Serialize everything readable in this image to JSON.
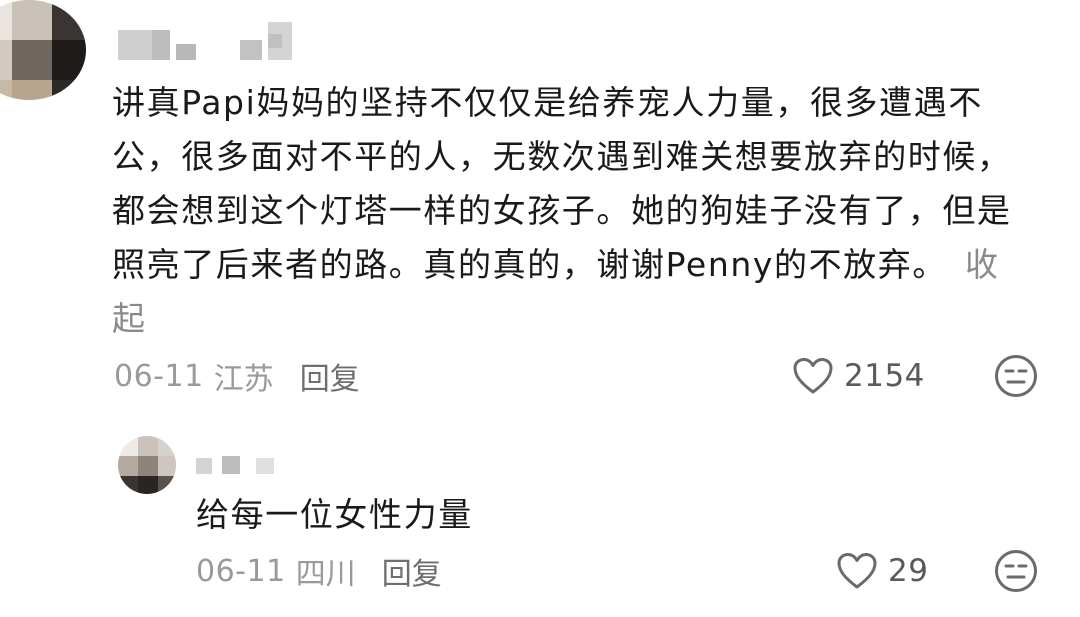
{
  "comment": {
    "text": "讲真Papi妈妈的坚持不仅仅是给养宠人力量，很多遭遇不公，很多面对不平的人，无数次遇到难关想要放弃的时候，都会想到这个灯塔一样的女孩子。她的狗娃子没有了，但是照亮了后来者的路。真的真的，谢谢Penny的不放弃。",
    "collapse_label": "收起",
    "date": "06-11",
    "location": "江苏",
    "reply_label": "回复",
    "like_count": "2154"
  },
  "reply": {
    "text": "给每一位女性力量",
    "date": "06-11",
    "location": "四川",
    "reply_label": "回复",
    "like_count": "29"
  },
  "icons": {
    "like": "heart-outline-icon",
    "dislike": "meh-face-icon"
  },
  "colors": {
    "text": "#1a1a1a",
    "meta": "#9a9a9a",
    "icon": "#6b6b6b"
  }
}
